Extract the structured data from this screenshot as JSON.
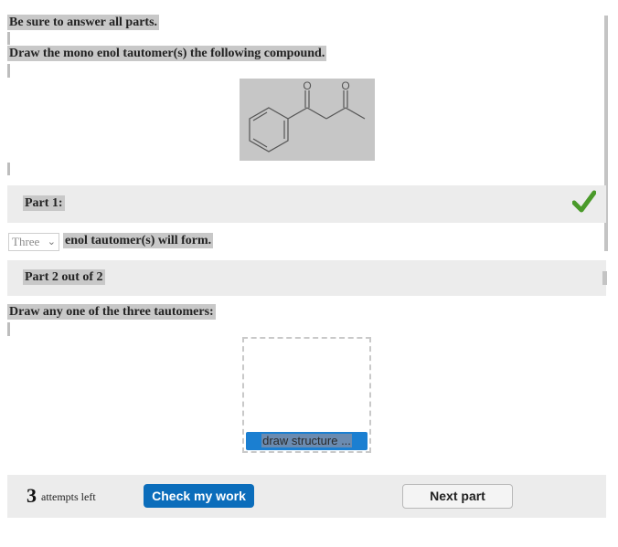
{
  "instructions": "Be sure to answer all parts.",
  "question": "Draw the mono enol tautomer(s) the following compound.",
  "compound": {
    "oxygen_label": "O",
    "icon": "compound-structure-icon"
  },
  "part1": {
    "title": "Part 1:",
    "status_icon": "checkmark-icon",
    "status_color": "#4a9a2a",
    "select_value": "Three",
    "sentence_rest": "enol tautomer(s) will form."
  },
  "part2": {
    "title": "Part 2 out of 2",
    "prompt": "Draw any one of the three tautomers:",
    "draw_button": "draw structure ..."
  },
  "footer": {
    "attempts_count": "3",
    "attempts_label": "attempts left",
    "check_button": "Check my work",
    "next_button": "Next part"
  },
  "colors": {
    "accent": "#0b6dbb",
    "band": "#ececec"
  }
}
